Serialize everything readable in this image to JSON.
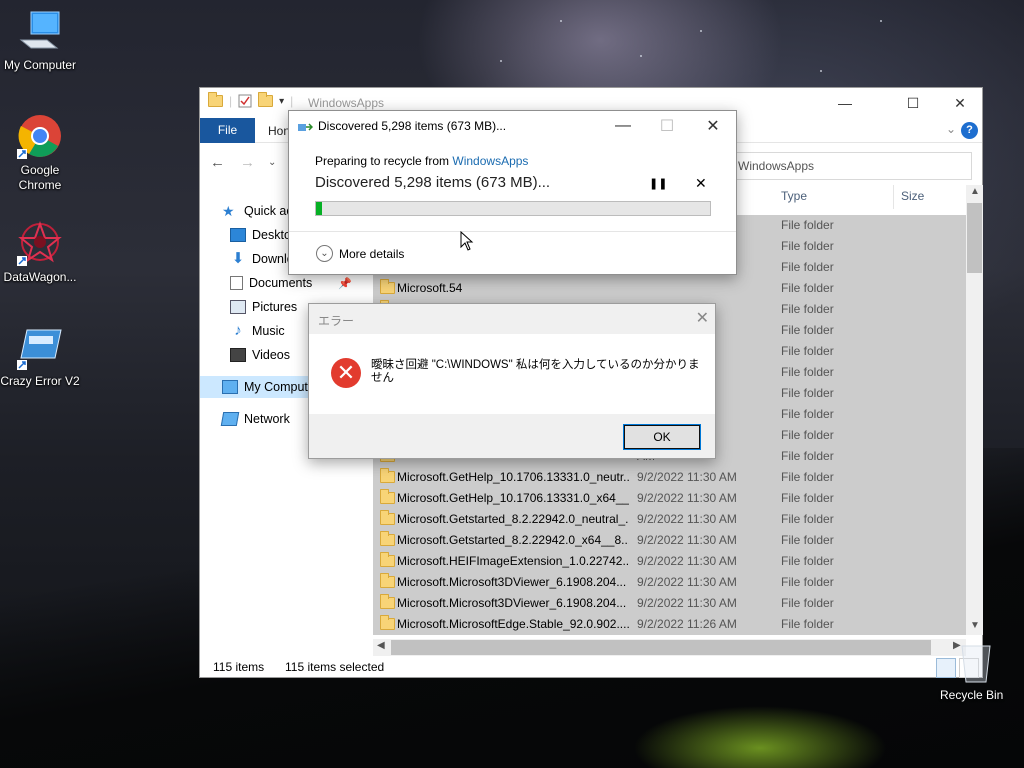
{
  "desktop": {
    "icons": [
      {
        "label": "My Computer"
      },
      {
        "label": "Google\nChrome"
      },
      {
        "label": "DataWagon..."
      },
      {
        "label": "Crazy Error V2"
      }
    ],
    "recycle_bin": "Recycle Bin"
  },
  "explorer": {
    "title": "WindowsApps",
    "ribbon": {
      "file_tab": "File",
      "home_tab": "Hon",
      "help": "?"
    },
    "address": "WindowsApps",
    "sidebar": [
      {
        "label": "Quick ac",
        "icon": "star-icon"
      },
      {
        "label": "Deskto",
        "icon": "desktop-icon"
      },
      {
        "label": "Downlo",
        "icon": "download-icon"
      },
      {
        "label": "Documents",
        "icon": "documents-icon"
      },
      {
        "label": "Pictures",
        "icon": "pictures-icon"
      },
      {
        "label": "Music",
        "icon": "music-icon"
      },
      {
        "label": "Videos",
        "icon": "videos-icon"
      },
      {
        "label": "My Comput",
        "icon": "computer-icon"
      },
      {
        "label": "Network",
        "icon": "network-icon"
      }
    ],
    "columns": {
      "type": "Type",
      "size": "Size"
    },
    "rows": [
      {
        "name": "",
        "date": "",
        "type": "File folder"
      },
      {
        "name": "",
        "date": "",
        "type": "File folder"
      },
      {
        "name": "",
        "date": "",
        "type": "File folder"
      },
      {
        "name": "Microsoft.54",
        "date": "",
        "type": "File folder"
      },
      {
        "name": "",
        "date": "M",
        "type": "File folder"
      },
      {
        "name": "",
        "date": "AM",
        "type": "File folder"
      },
      {
        "name": "",
        "date": "AM",
        "type": "File folder"
      },
      {
        "name": "",
        "date": "AM",
        "type": "File folder"
      },
      {
        "name": "",
        "date": "AM",
        "type": "File folder"
      },
      {
        "name": "",
        "date": "AM",
        "type": "File folder"
      },
      {
        "name": "",
        "date": "AM",
        "type": "File folder"
      },
      {
        "name": "",
        "date": "AM",
        "type": "File folder"
      },
      {
        "name": "Microsoft.GetHelp_10.1706.13331.0_neutr...",
        "date": "9/2/2022 11:30 AM",
        "type": "File folder"
      },
      {
        "name": "Microsoft.GetHelp_10.1706.13331.0_x64__...",
        "date": "9/2/2022 11:30 AM",
        "type": "File folder"
      },
      {
        "name": "Microsoft.Getstarted_8.2.22942.0_neutral_...",
        "date": "9/2/2022 11:30 AM",
        "type": "File folder"
      },
      {
        "name": "Microsoft.Getstarted_8.2.22942.0_x64__8...",
        "date": "9/2/2022 11:30 AM",
        "type": "File folder"
      },
      {
        "name": "Microsoft.HEIFImageExtension_1.0.22742...",
        "date": "9/2/2022 11:30 AM",
        "type": "File folder"
      },
      {
        "name": "Microsoft.Microsoft3DViewer_6.1908.204...",
        "date": "9/2/2022 11:30 AM",
        "type": "File folder"
      },
      {
        "name": "Microsoft.Microsoft3DViewer_6.1908.204...",
        "date": "9/2/2022 11:30 AM",
        "type": "File folder"
      },
      {
        "name": "Microsoft.MicrosoftEdge.Stable_92.0.902....",
        "date": "9/2/2022 11:26 AM",
        "type": "File folder"
      }
    ],
    "status": {
      "items": "115 items",
      "selected": "115 items selected"
    }
  },
  "progress_dialog": {
    "title": "Discovered 5,298 items (673 MB)...",
    "preparing_prefix": "Preparing to recycle from ",
    "preparing_link": "WindowsApps",
    "headline": "Discovered 5,298 items (673 MB)...",
    "progress_fraction": 0.015,
    "more_details": "More details"
  },
  "error_dialog": {
    "title": "エラー",
    "message": "曖昧さ回避 \"C:\\WINDOWS\" 私は何を入力しているのか分かりません",
    "ok": "OK"
  },
  "colors": {
    "file_tab": "#19579e",
    "selection": "#cccccc",
    "progress_fill": "#06b025",
    "error_icon": "#e23b2e",
    "link": "#1a6bb0"
  }
}
